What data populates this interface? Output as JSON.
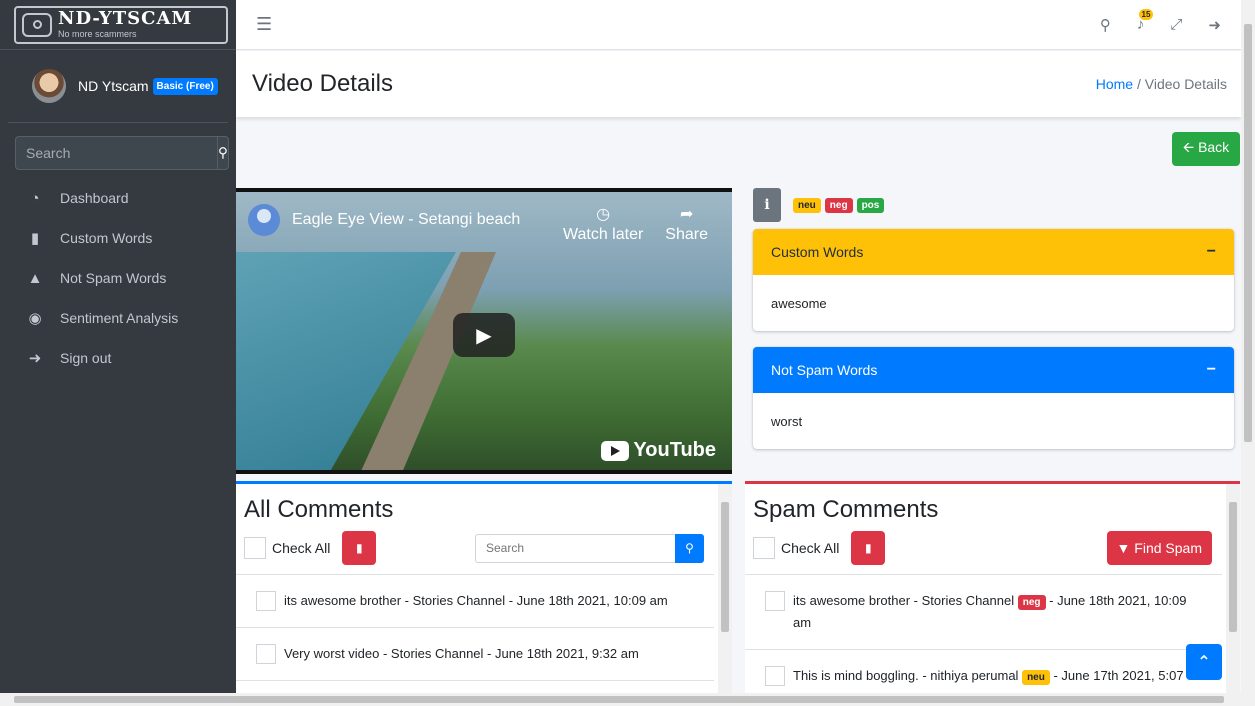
{
  "brand": {
    "title": "ND-YTSCAM",
    "subtitle": "No more scammers"
  },
  "user": {
    "name": "ND Ytscam",
    "plan": "Basic (Free)"
  },
  "sidebar": {
    "search_placeholder": "Search",
    "items": [
      {
        "label": "Dashboard",
        "icon": "dashboard-icon"
      },
      {
        "label": "Custom Words",
        "icon": "trash-icon"
      },
      {
        "label": "Not Spam Words",
        "icon": "thumbs-up-icon"
      },
      {
        "label": "Sentiment Analysis",
        "icon": "comments-icon"
      },
      {
        "label": "Sign out",
        "icon": "sign-out-icon"
      }
    ]
  },
  "topbar": {
    "notification_count": "15"
  },
  "header": {
    "title": "Video Details",
    "breadcrumb_home": "Home",
    "breadcrumb_sep": "/",
    "breadcrumb_current": "Video Details"
  },
  "back_button": "Back",
  "video": {
    "title": "Eagle Eye View - Setangi beach",
    "watch_later": "Watch later",
    "share": "Share",
    "brand": "YouTube"
  },
  "legend": {
    "info": "i",
    "neu": "neu",
    "neg": "neg",
    "pos": "pos"
  },
  "custom_words": {
    "title": "Custom Words",
    "collapse": "−",
    "words": "awesome",
    "color": "#ffc107"
  },
  "not_spam_words": {
    "title": "Not Spam Words",
    "collapse": "−",
    "words": "worst",
    "color": "#007bff"
  },
  "all_comments": {
    "title": "All Comments",
    "check_all": "Check All",
    "search_placeholder": "Search",
    "items": [
      {
        "text": "its awesome brother - Stories Channel - June 18th 2021, 10:09 am"
      },
      {
        "text": "Very worst video - Stories Channel - June 18th 2021, 9:32 am"
      }
    ]
  },
  "spam_comments": {
    "title": "Spam Comments",
    "check_all": "Check All",
    "find_spam": "Find Spam",
    "items": [
      {
        "text": "its awesome brother - Stories Channel",
        "badge": "neg",
        "date": "- June 18th 2021, 10:09 am"
      },
      {
        "text": "This is mind boggling. - nithiya perumal",
        "badge": "neu",
        "date": "- June 17th 2021, 5:07"
      }
    ]
  }
}
